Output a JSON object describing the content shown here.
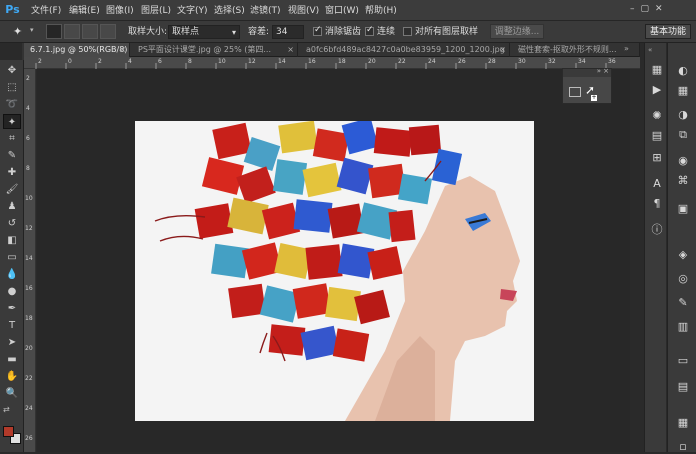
{
  "app": {
    "logo": "Ps"
  },
  "menu": [
    "文件(F)",
    "编辑(E)",
    "图像(I)",
    "图层(L)",
    "文字(Y)",
    "选择(S)",
    "滤镜(T)",
    "视图(V)",
    "窗口(W)",
    "帮助(H)"
  ],
  "options": {
    "sample_size_label": "取样大小:",
    "sample_size_value": "取样点",
    "tolerance_label": "容差:",
    "tolerance_value": "34",
    "antialias_label": "消除锯齿",
    "contiguous_label": "连续",
    "all_layers_label": "对所有图层取样",
    "refine_edge_label": "调整边缘...",
    "workspace_label": "基本功能"
  },
  "tabs": [
    {
      "label": "6.7.1.jpg @ 50%(RGB/8) *"
    },
    {
      "label": "PS平面设计课堂.jpg @ 25% (第四..."
    },
    {
      "label": "a0fc6bfd489ac8427c0a0be83959_1200_1200.jpg"
    },
    {
      "label": "磁性套索-抠取外形不规则..."
    }
  ],
  "ruler_top": [
    "2",
    "0",
    "2",
    "4",
    "6",
    "8",
    "10",
    "12",
    "14",
    "16",
    "18",
    "20",
    "22",
    "24",
    "26",
    "28",
    "30",
    "32",
    "34",
    "36"
  ],
  "ruler_left": [
    "2",
    "4",
    "6",
    "8",
    "10",
    "12",
    "14",
    "16",
    "18",
    "20",
    "22",
    "24",
    "26"
  ],
  "colors": {
    "accent": "#3fa9f5",
    "foreground": "#b23a2a",
    "background": "#e0e0e0"
  }
}
